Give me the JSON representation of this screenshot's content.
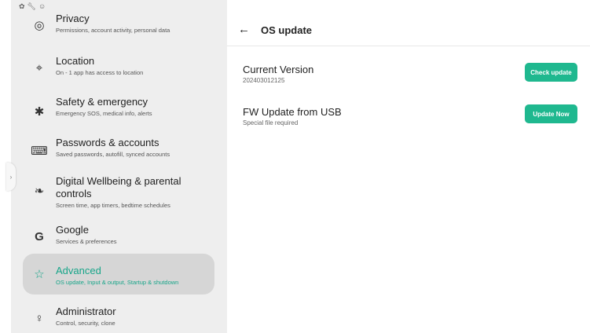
{
  "status_icons": [
    "settings-gear-icon",
    "wrench-icon",
    "android-icon"
  ],
  "sidebar": {
    "items": [
      {
        "icon": "privacy-icon",
        "glyph": "◎",
        "title": "Privacy",
        "subtitle": "Permissions, account activity, personal data"
      },
      {
        "icon": "location-pin-icon",
        "glyph": "⌖",
        "title": "Location",
        "subtitle": "On - 1 app has access to location"
      },
      {
        "icon": "asterisk-icon",
        "glyph": "✱",
        "title": "Safety & emergency",
        "subtitle": "Emergency SOS, medical info, alerts"
      },
      {
        "icon": "password-key-icon",
        "glyph": "⌨",
        "title": "Passwords & accounts",
        "subtitle": "Saved passwords, autofill, synced accounts"
      },
      {
        "icon": "wellbeing-icon",
        "glyph": "❧",
        "title": "Digital Wellbeing & parental controls",
        "subtitle": "Screen time, app timers, bedtime schedules"
      },
      {
        "icon": "google-g-icon",
        "glyph": "G",
        "title": "Google",
        "subtitle": "Services & preferences"
      },
      {
        "icon": "advanced-icon",
        "glyph": "☆",
        "title": "Advanced",
        "subtitle": "OS update, Input & output, Startup & shutdown"
      },
      {
        "icon": "administrator-icon",
        "glyph": "♀",
        "title": "Administrator",
        "subtitle": "Control, security, clone"
      }
    ]
  },
  "main": {
    "title": "OS update",
    "back_icon": "arrow-back-icon",
    "rows": [
      {
        "title": "Current Version",
        "subtitle": "202403012125",
        "button": "Check update"
      },
      {
        "title": "FW Update from USB",
        "subtitle": "Special file required",
        "button": "Update Now"
      }
    ]
  },
  "colors": {
    "accent": "#1fb88f",
    "active_text": "#17a589",
    "sidebar_bg": "#eeeeee",
    "active_bg": "#d6d6d6"
  }
}
